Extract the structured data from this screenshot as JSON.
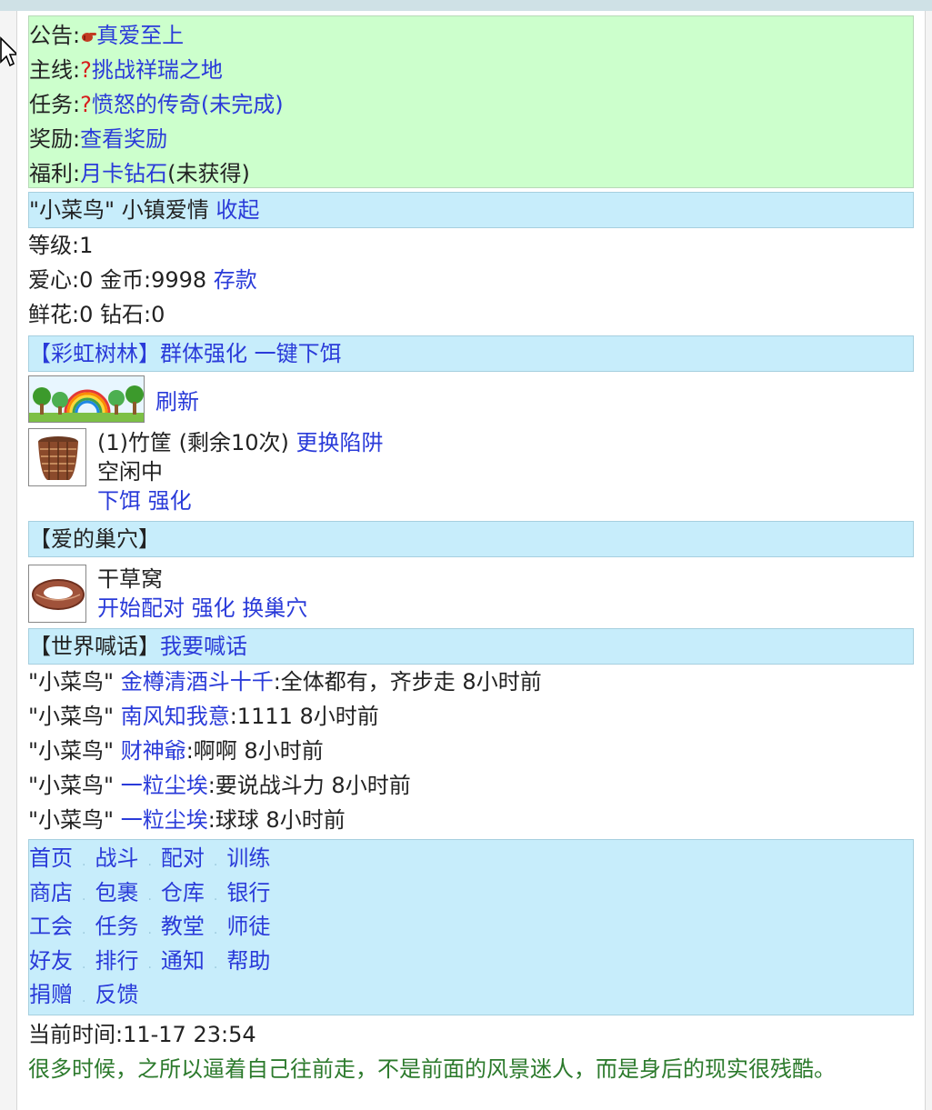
{
  "notice": {
    "announce_label": "公告:",
    "announce_link": "真爱至上",
    "main_label": "主线:",
    "main_mark": "?",
    "main_link": "挑战祥瑞之地",
    "task_label": "任务:",
    "task_mark": "?",
    "task_link": "愤怒的传奇(未完成)",
    "reward_label": "奖励:",
    "reward_link": "查看奖励",
    "welfare_label": "福利:",
    "welfare_link": "月卡钻石",
    "welfare_status": "(未获得)"
  },
  "profile": {
    "header_name": "\"小菜鸟\" 小镇爱情",
    "collapse_link": "收起",
    "level": "等级:1",
    "love_gold": "爱心:0 金币:9998",
    "deposit_link": "存款",
    "flower_diamond": "鲜花:0 钻石:0"
  },
  "forest": {
    "header_title": "【彩虹树林】",
    "group_boost_link": "群体强化",
    "one_key_bait_link": "一键下饵",
    "refresh_link": "刷新",
    "trap_info": "(1)竹筐 (剩余10次)",
    "change_trap_link": "更换陷阱",
    "trap_status": "空闲中",
    "bait_link": "下饵",
    "boost_link": "强化"
  },
  "nest": {
    "header_title": "【爱的巢穴】",
    "nest_name": "干草窝",
    "start_pair_link": "开始配对",
    "boost_link": "强化",
    "change_nest_link": "换巢穴"
  },
  "shout": {
    "header_title": "【世界喊话】",
    "shout_link": "我要喊话",
    "messages": [
      {
        "sender": "\"小菜鸟\"",
        "user": "金樽清酒斗十千",
        "text": ":全体都有，齐步走 8小时前"
      },
      {
        "sender": "\"小菜鸟\"",
        "user": "南风知我意",
        "text": ":1111 8小时前"
      },
      {
        "sender": "\"小菜鸟\"",
        "user": "财神爺",
        "text": ":啊啊 8小时前"
      },
      {
        "sender": "\"小菜鸟\"",
        "user": "一粒尘埃",
        "text": ":要说战斗力 8小时前"
      },
      {
        "sender": "\"小菜鸟\"",
        "user": "一粒尘埃",
        "text": ":球球 8小时前"
      }
    ]
  },
  "menu": {
    "rows": [
      [
        "首页",
        "战斗",
        "配对",
        "训练"
      ],
      [
        "商店",
        "包裹",
        "仓库",
        "银行"
      ],
      [
        "工会",
        "任务",
        "教堂",
        "师徒"
      ],
      [
        "好友",
        "排行",
        "通知",
        "帮助"
      ],
      [
        "捐赠",
        "反馈"
      ]
    ],
    "separator": "."
  },
  "footer": {
    "current_time": "当前时间:11-17 23:54",
    "quote": "很多时候，之所以逼着自己往前走，不是前面的风景迷人，而是身后的现实很残酷。"
  },
  "colors": {
    "link": "#2a3bd9",
    "notice_bg": "#ccffcc",
    "bar_bg": "#c7edfb",
    "quote": "#2c7a2c",
    "mark": "#d71c1c"
  },
  "icons": {
    "announce": "pointing-hand-icon",
    "cursor": "mouse-pointer-icon"
  }
}
